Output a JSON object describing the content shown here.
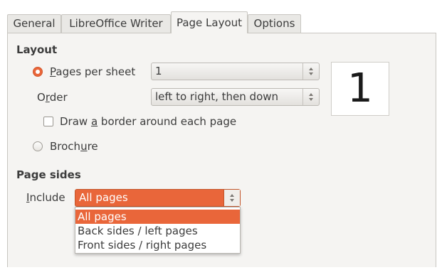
{
  "tabs": [
    {
      "label": "General"
    },
    {
      "label": "LibreOffice Writer"
    },
    {
      "label": "Page Layout",
      "active": true
    },
    {
      "label": "Options"
    }
  ],
  "layout": {
    "heading": "Layout",
    "pages_per_sheet": {
      "pre": "",
      "ul": "P",
      "post": "ages per sheet",
      "value": "1",
      "selected": true
    },
    "order": {
      "pre": "O",
      "ul": "r",
      "post": "der",
      "value": "left to right, then down"
    },
    "border": {
      "pre": "Draw ",
      "ul": "a",
      "post": " border around each page",
      "checked": false
    },
    "brochure": {
      "pre": "Broch",
      "ul": "u",
      "post": "re",
      "selected": false
    },
    "preview_value": "1"
  },
  "page_sides": {
    "heading": "Page sides",
    "include": {
      "pre": "",
      "ul": "I",
      "post": "nclude",
      "value": "All pages"
    },
    "options": [
      "All pages",
      "Back sides / left pages",
      "Front sides / right pages"
    ],
    "selected_index": 0
  },
  "colors": {
    "accent": "#e9663a",
    "panel": "#f5f4f2"
  }
}
